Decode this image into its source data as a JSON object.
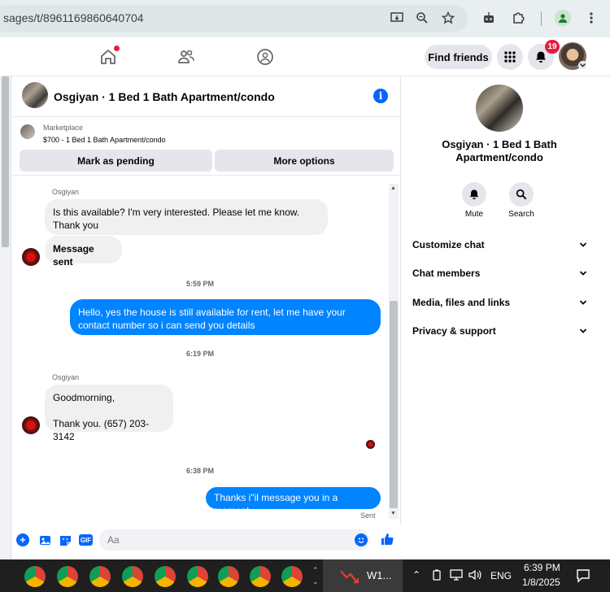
{
  "browser": {
    "url": "sages/t/8961169860640704"
  },
  "header": {
    "find_friends": "Find friends",
    "notification_count": "19"
  },
  "chat": {
    "title": "Osgiyan · 1 Bed 1 Bath Apartment/condo",
    "marketplace": {
      "label": "Marketplace",
      "listing": "$700 - 1 Bed 1 Bath Apartment/condo",
      "mark_pending": "Mark as pending",
      "more_options": "More options"
    },
    "messages": [
      {
        "sender": "Osgiyan",
        "text_line1": "Is this available? I'm very interested. Please let me know.",
        "text_line2": "Thank you"
      },
      {
        "text": "Message sent"
      },
      {
        "time": "5:59 PM"
      },
      {
        "text_line1": "Hello, yes the house is still available for rent, let me have your",
        "text_line2": "contact number so i can send you  details"
      },
      {
        "time": "6:19 PM"
      },
      {
        "sender": "Osgiyan",
        "text_line1": "Goodmorning,",
        "text_line2": "Thank you. (657) 203-3142"
      },
      {
        "time": "6:38 PM"
      },
      {
        "text": "Thanks i\"il message you in a moment",
        "status": "Sent"
      }
    ],
    "composer": {
      "placeholder": "Aa",
      "gif_label": "GIF"
    }
  },
  "right_panel": {
    "title": "Osgiyan · 1 Bed 1 Bath Apartment/condo",
    "actions": [
      {
        "label": "Mute",
        "icon": "bell-icon"
      },
      {
        "label": "Search",
        "icon": "search-icon"
      }
    ],
    "sections": [
      "Customize chat",
      "Chat members",
      "Media, files and links",
      "Privacy & support"
    ]
  },
  "taskbar": {
    "app_label": "W1...",
    "language": "ENG",
    "time": "6:39 PM",
    "date": "1/8/2025"
  },
  "colors": {
    "messenger_blue": "#0084ff",
    "fb_blue": "#0866ff",
    "badge_red": "#e41e3f"
  }
}
